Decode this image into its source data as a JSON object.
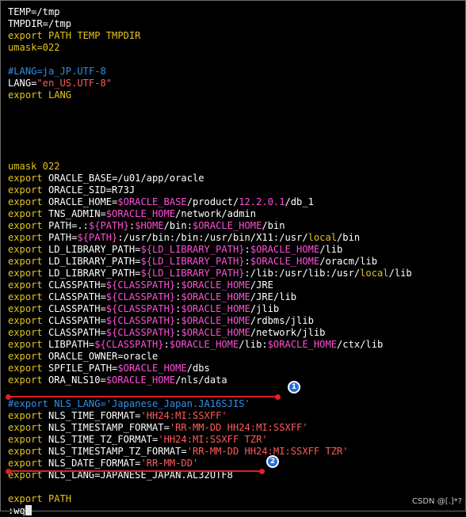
{
  "colors": {
    "white": "#ffffff",
    "yellow": "#e2c41f",
    "magenta": "#ff4fd8",
    "red": "#ff5a5a",
    "blue": "#2f8fe8",
    "annotation_red": "#e02020",
    "badge_blue": "#1f6fe0"
  },
  "lines": [
    [
      {
        "t": "TEMP=/tmp",
        "c": "white"
      }
    ],
    [
      {
        "t": "TMPDIR=/tmp",
        "c": "white"
      }
    ],
    [
      {
        "t": "export PATH TEMP TMPDIR",
        "c": "yellow"
      }
    ],
    [
      {
        "t": "umask=022",
        "c": "yellow"
      }
    ],
    [],
    [
      {
        "t": "#LANG=ja_JP.UTF-8",
        "c": "blue"
      }
    ],
    [
      {
        "t": "LANG=",
        "c": "white"
      },
      {
        "t": "\"en_US.UTF-8\"",
        "c": "red"
      }
    ],
    [
      {
        "t": "export LANG",
        "c": "yellow"
      }
    ],
    [],
    [],
    [],
    [],
    [],
    [
      {
        "t": "umask 022",
        "c": "yellow"
      }
    ],
    [
      {
        "t": "export ",
        "c": "yellow"
      },
      {
        "t": "ORACLE_BASE=/u01/app/oracle",
        "c": "white"
      }
    ],
    [
      {
        "t": "export ",
        "c": "yellow"
      },
      {
        "t": "ORACLE_SID=R73J",
        "c": "white"
      }
    ],
    [
      {
        "t": "export ",
        "c": "yellow"
      },
      {
        "t": "ORACLE_HOME=",
        "c": "white"
      },
      {
        "t": "$ORACLE_BASE",
        "c": "magenta"
      },
      {
        "t": "/product/",
        "c": "white"
      },
      {
        "t": "12.2.0.1",
        "c": "magenta"
      },
      {
        "t": "/db_1",
        "c": "white"
      }
    ],
    [
      {
        "t": "export ",
        "c": "yellow"
      },
      {
        "t": "TNS_ADMIN=",
        "c": "white"
      },
      {
        "t": "$ORACLE_HOME",
        "c": "magenta"
      },
      {
        "t": "/network/admin",
        "c": "white"
      }
    ],
    [
      {
        "t": "export ",
        "c": "yellow"
      },
      {
        "t": "PATH=.:",
        "c": "white"
      },
      {
        "t": "${PATH}",
        "c": "magenta"
      },
      {
        "t": ":",
        "c": "white"
      },
      {
        "t": "$HOME",
        "c": "magenta"
      },
      {
        "t": "/bin:",
        "c": "white"
      },
      {
        "t": "$ORACLE_HOME",
        "c": "magenta"
      },
      {
        "t": "/bin",
        "c": "white"
      }
    ],
    [
      {
        "t": "export ",
        "c": "yellow"
      },
      {
        "t": "PATH=",
        "c": "white"
      },
      {
        "t": "${PATH}",
        "c": "magenta"
      },
      {
        "t": ":/usr/bin:/bin:/usr/bin/X11:/usr/",
        "c": "white"
      },
      {
        "t": "local",
        "c": "yellow"
      },
      {
        "t": "/bin",
        "c": "white"
      }
    ],
    [
      {
        "t": "export ",
        "c": "yellow"
      },
      {
        "t": "LD_LIBRARY_PATH=",
        "c": "white"
      },
      {
        "t": "${LD_LIBRARY_PATH}",
        "c": "magenta"
      },
      {
        "t": ":",
        "c": "white"
      },
      {
        "t": "$ORACLE_HOME",
        "c": "magenta"
      },
      {
        "t": "/lib",
        "c": "white"
      }
    ],
    [
      {
        "t": "export ",
        "c": "yellow"
      },
      {
        "t": "LD_LIBRARY_PATH=",
        "c": "white"
      },
      {
        "t": "${LD_LIBRARY_PATH}",
        "c": "magenta"
      },
      {
        "t": ":",
        "c": "white"
      },
      {
        "t": "$ORACLE_HOME",
        "c": "magenta"
      },
      {
        "t": "/oracm/lib",
        "c": "white"
      }
    ],
    [
      {
        "t": "export ",
        "c": "yellow"
      },
      {
        "t": "LD_LIBRARY_PATH=",
        "c": "white"
      },
      {
        "t": "${LD_LIBRARY_PATH}",
        "c": "magenta"
      },
      {
        "t": ":/lib:/usr/lib:/usr/",
        "c": "white"
      },
      {
        "t": "local",
        "c": "yellow"
      },
      {
        "t": "/lib",
        "c": "white"
      }
    ],
    [
      {
        "t": "export ",
        "c": "yellow"
      },
      {
        "t": "CLASSPATH=",
        "c": "white"
      },
      {
        "t": "${CLASSPATH}",
        "c": "magenta"
      },
      {
        "t": ":",
        "c": "white"
      },
      {
        "t": "$ORACLE_HOME",
        "c": "magenta"
      },
      {
        "t": "/JRE",
        "c": "white"
      }
    ],
    [
      {
        "t": "export ",
        "c": "yellow"
      },
      {
        "t": "CLASSPATH=",
        "c": "white"
      },
      {
        "t": "${CLASSPATH}",
        "c": "magenta"
      },
      {
        "t": ":",
        "c": "white"
      },
      {
        "t": "$ORACLE_HOME",
        "c": "magenta"
      },
      {
        "t": "/JRE/lib",
        "c": "white"
      }
    ],
    [
      {
        "t": "export ",
        "c": "yellow"
      },
      {
        "t": "CLASSPATH=",
        "c": "white"
      },
      {
        "t": "${CLASSPATH}",
        "c": "magenta"
      },
      {
        "t": ":",
        "c": "white"
      },
      {
        "t": "$ORACLE_HOME",
        "c": "magenta"
      },
      {
        "t": "/jlib",
        "c": "white"
      }
    ],
    [
      {
        "t": "export ",
        "c": "yellow"
      },
      {
        "t": "CLASSPATH=",
        "c": "white"
      },
      {
        "t": "${CLASSPATH}",
        "c": "magenta"
      },
      {
        "t": ":",
        "c": "white"
      },
      {
        "t": "$ORACLE_HOME",
        "c": "magenta"
      },
      {
        "t": "/rdbms/jlib",
        "c": "white"
      }
    ],
    [
      {
        "t": "export ",
        "c": "yellow"
      },
      {
        "t": "CLASSPATH=",
        "c": "white"
      },
      {
        "t": "${CLASSPATH}",
        "c": "magenta"
      },
      {
        "t": ":",
        "c": "white"
      },
      {
        "t": "$ORACLE_HOME",
        "c": "magenta"
      },
      {
        "t": "/network/jlib",
        "c": "white"
      }
    ],
    [
      {
        "t": "export ",
        "c": "yellow"
      },
      {
        "t": "LIBPATH=",
        "c": "white"
      },
      {
        "t": "${CLASSPATH}",
        "c": "magenta"
      },
      {
        "t": ":",
        "c": "white"
      },
      {
        "t": "$ORACLE_HOME",
        "c": "magenta"
      },
      {
        "t": "/lib:",
        "c": "white"
      },
      {
        "t": "$ORACLE_HOME",
        "c": "magenta"
      },
      {
        "t": "/ctx/lib",
        "c": "white"
      }
    ],
    [
      {
        "t": "export ",
        "c": "yellow"
      },
      {
        "t": "ORACLE_OWNER=oracle",
        "c": "white"
      }
    ],
    [
      {
        "t": "export ",
        "c": "yellow"
      },
      {
        "t": "SPFILE_PATH=",
        "c": "white"
      },
      {
        "t": "$ORACLE_HOME",
        "c": "magenta"
      },
      {
        "t": "/dbs",
        "c": "white"
      }
    ],
    [
      {
        "t": "export ",
        "c": "yellow"
      },
      {
        "t": "ORA_NLS10=",
        "c": "white"
      },
      {
        "t": "$ORACLE_HOME",
        "c": "magenta"
      },
      {
        "t": "/nls/data",
        "c": "white"
      }
    ],
    [],
    [
      {
        "t": "#export NLS_LANG='Japanese_Japan.JA16SJIS'",
        "c": "blue"
      }
    ],
    [
      {
        "t": "export ",
        "c": "yellow"
      },
      {
        "t": "NLS_TIME_FORMAT=",
        "c": "white"
      },
      {
        "t": "'HH24:MI:SSXFF'",
        "c": "red"
      }
    ],
    [
      {
        "t": "export ",
        "c": "yellow"
      },
      {
        "t": "NLS_TIMESTAMP_FORMAT=",
        "c": "white"
      },
      {
        "t": "'RR-MM-DD HH24:MI:SSXFF'",
        "c": "red"
      }
    ],
    [
      {
        "t": "export ",
        "c": "yellow"
      },
      {
        "t": "NLS_TIME_TZ_FORMAT=",
        "c": "white"
      },
      {
        "t": "'HH24:MI:SSXFF TZR'",
        "c": "red"
      }
    ],
    [
      {
        "t": "export ",
        "c": "yellow"
      },
      {
        "t": "NLS_TIMESTAMP_TZ_FORMAT=",
        "c": "white"
      },
      {
        "t": "'RR-MM-DD HH24:MI:SSXFF TZR'",
        "c": "red"
      }
    ],
    [
      {
        "t": "export ",
        "c": "yellow"
      },
      {
        "t": "NLS_DATE_FORMAT=",
        "c": "white"
      },
      {
        "t": "'RR-MM-DD'",
        "c": "red"
      }
    ],
    [
      {
        "t": "export ",
        "c": "yellow"
      },
      {
        "t": "NLS_LANG=JAPANESE_JAPAN.AL32UTF8",
        "c": "white"
      }
    ],
    [],
    [
      {
        "t": "export PATH",
        "c": "yellow"
      }
    ],
    [
      {
        "t": ":wq",
        "c": "white"
      }
    ]
  ],
  "annotations": {
    "badge_1": "1",
    "badge_2": "2"
  },
  "watermark": "CSDN @[.]*?"
}
